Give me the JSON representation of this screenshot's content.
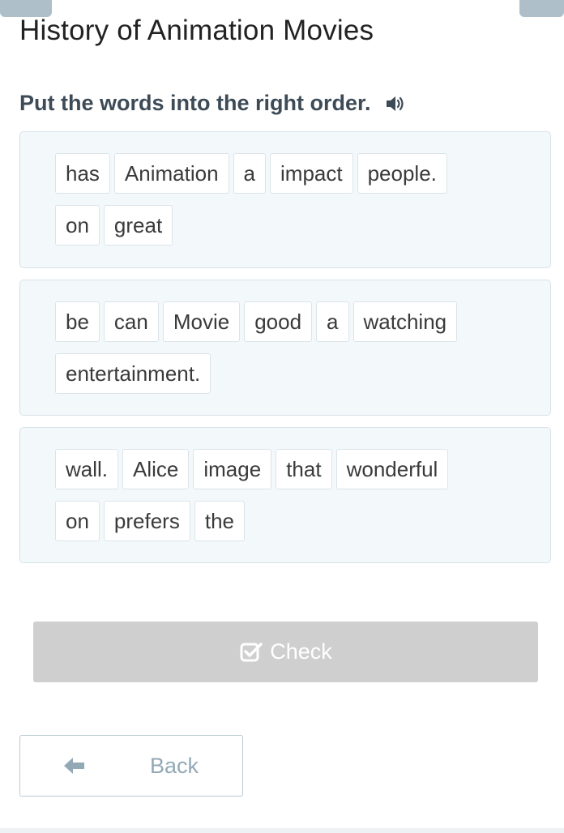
{
  "page": {
    "title": "History of Animation Movies"
  },
  "exercise": {
    "instruction": "Put the words into the right order.",
    "audio_icon": "speaker-icon",
    "sentences": [
      {
        "rows": [
          [
            "has",
            "Animation",
            "a",
            "impact",
            "people."
          ],
          [
            "on",
            "great"
          ]
        ]
      },
      {
        "rows": [
          [
            "be",
            "can",
            "Movie",
            "good",
            "a",
            "watching"
          ],
          [
            "entertainment."
          ]
        ]
      },
      {
        "rows": [
          [
            "wall.",
            "Alice",
            "image",
            "that",
            "wonderful"
          ],
          [
            "on",
            "prefers",
            "the"
          ]
        ]
      }
    ]
  },
  "actions": {
    "check_label": "Check",
    "check_icon": "checkbox-check-icon",
    "check_enabled": false,
    "back_label": "Back",
    "back_icon": "arrow-left-icon"
  },
  "colors": {
    "box_background": "#f3f8fb",
    "box_border": "#d6e3ea",
    "check_disabled": "#cfcfcf",
    "back_text": "#93a9b6",
    "instruction_text": "#3d4b57"
  }
}
